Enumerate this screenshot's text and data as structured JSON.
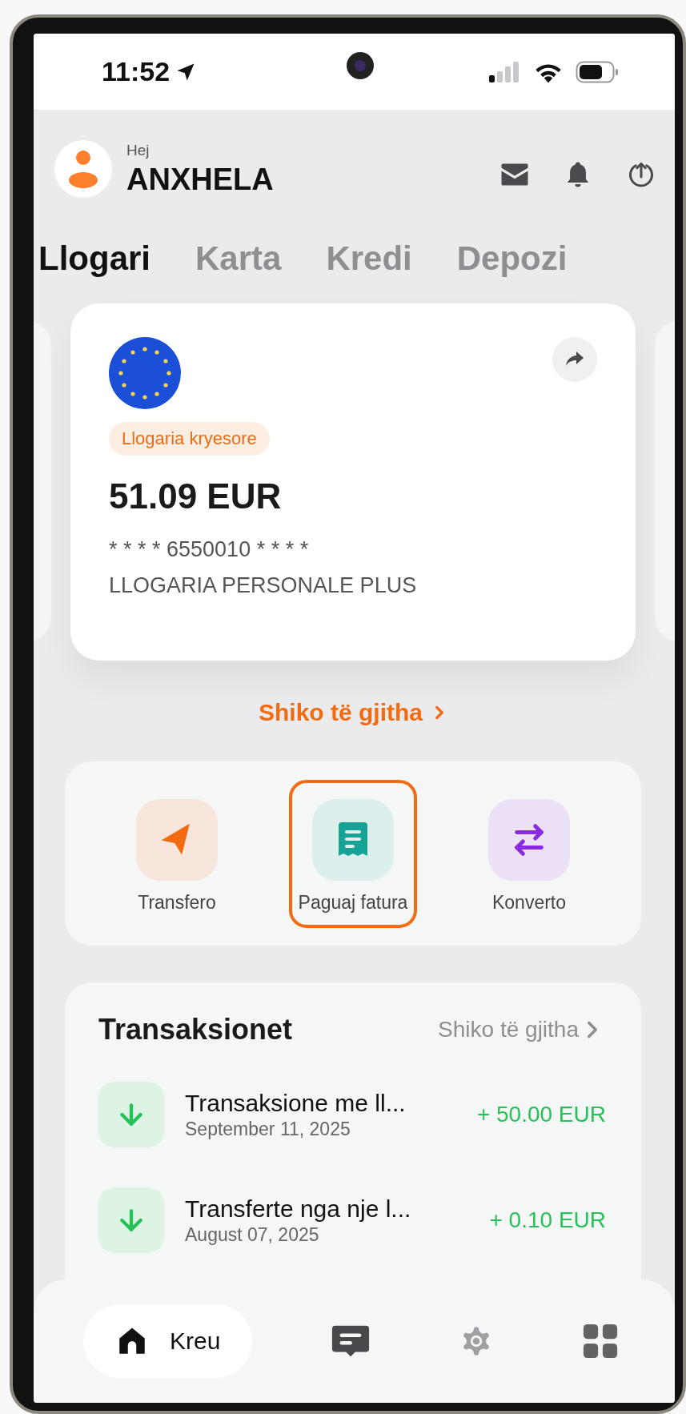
{
  "status_bar": {
    "time": "11:52"
  },
  "header": {
    "greeting": "Hej",
    "name": "ANXHELA"
  },
  "tabs": [
    {
      "label": "Llogari",
      "selected": true
    },
    {
      "label": "Karta",
      "selected": false
    },
    {
      "label": "Kredi",
      "selected": false
    },
    {
      "label": "Depozi",
      "selected": false
    }
  ],
  "account_card": {
    "badge": "Llogaria kryesore",
    "balance": "51.09 EUR",
    "account_number": "* * * * 6550010 * * * *",
    "account_type": "LLOGARIA PERSONALE PLUS"
  },
  "view_all_link": "Shiko të gjitha",
  "actions": [
    {
      "kind": "send",
      "label": "Transfero",
      "highlighted": false
    },
    {
      "kind": "bill",
      "label": "Paguaj fatura",
      "highlighted": true
    },
    {
      "kind": "convert",
      "label": "Konverto",
      "highlighted": false
    }
  ],
  "transactions": {
    "title": "Transaksionet",
    "view_all": "Shiko të gjitha",
    "items": [
      {
        "title": "Transaksione me ll...",
        "date": "September 11, 2025",
        "amount": "+ 50.00 EUR"
      },
      {
        "title": "Transferte nga nje l...",
        "date": "August 07, 2025",
        "amount": "+ 0.10 EUR"
      }
    ]
  },
  "bottom_nav": [
    {
      "kind": "home",
      "label": "Kreu",
      "selected": true
    },
    {
      "kind": "chat",
      "selected": false
    },
    {
      "kind": "settings",
      "selected": false
    },
    {
      "kind": "apps",
      "selected": false
    }
  ]
}
